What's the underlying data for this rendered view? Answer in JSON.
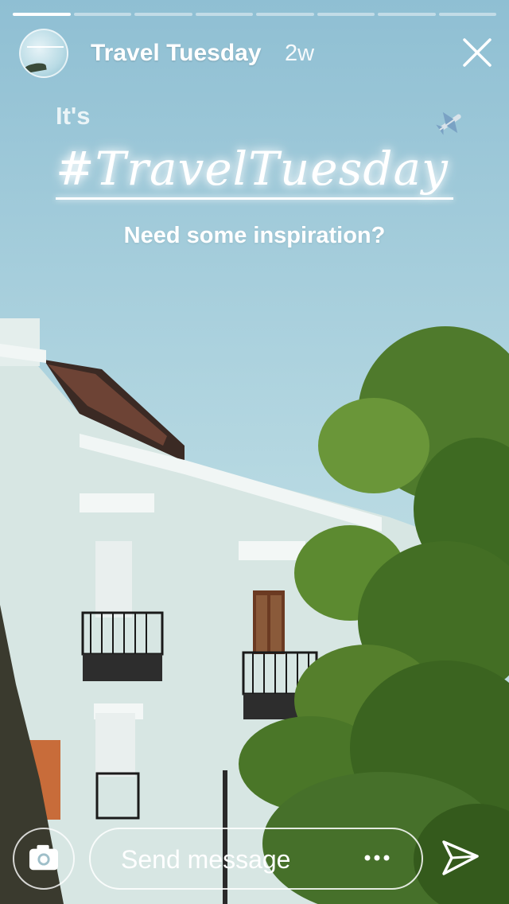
{
  "story": {
    "progress_segments": 8,
    "active_segment": 1
  },
  "header": {
    "account_name": "Travel Tuesday",
    "post_age": "2w",
    "close_icon": "close-icon"
  },
  "story_text": {
    "intro": "It's",
    "hashtag": "#TravelTuesday",
    "subtitle": "Need some inspiration?",
    "emoji_icon": "airplane-icon"
  },
  "bottom_bar": {
    "camera_icon": "camera-icon",
    "message_placeholder": "Send message",
    "more_icon": "more-icon",
    "send_icon": "send-icon"
  },
  "colors": {
    "accent_text": "#ffffff"
  }
}
